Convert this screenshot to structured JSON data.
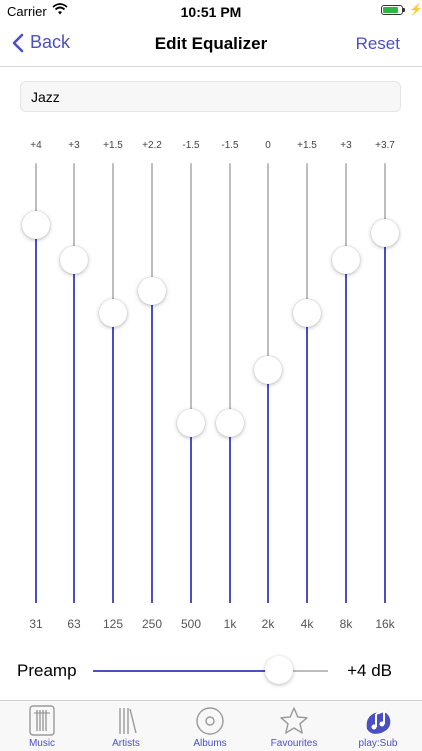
{
  "status_bar": {
    "carrier": "Carrier",
    "time": "10:51 PM"
  },
  "nav": {
    "back_label": "Back",
    "title": "Edit Equalizer",
    "reset_label": "Reset"
  },
  "preset": {
    "value": "Jazz"
  },
  "equalizer": {
    "range_db": [
      -12,
      12
    ],
    "bands": [
      {
        "label": "31",
        "value_text": "+4",
        "level": 0.86
      },
      {
        "label": "63",
        "value_text": "+3",
        "level": 0.78
      },
      {
        "label": "125",
        "value_text": "+1.5",
        "level": 0.66
      },
      {
        "label": "250",
        "value_text": "+2.2",
        "level": 0.71
      },
      {
        "label": "500",
        "value_text": "-1.5",
        "level": 0.41
      },
      {
        "label": "1k",
        "value_text": "-1.5",
        "level": 0.41
      },
      {
        "label": "2k",
        "value_text": "0",
        "level": 0.53
      },
      {
        "label": "4k",
        "value_text": "+1.5",
        "level": 0.66
      },
      {
        "label": "8k",
        "value_text": "+3",
        "level": 0.78
      },
      {
        "label": "16k",
        "value_text": "+3.7",
        "level": 0.84
      }
    ]
  },
  "preamp": {
    "label": "Preamp",
    "value_text": "+4 dB",
    "level": 0.79
  },
  "tabs": [
    {
      "label": "Music",
      "icon": "music-library-icon"
    },
    {
      "label": "Artists",
      "icon": "artists-icon"
    },
    {
      "label": "Albums",
      "icon": "album-disc-icon"
    },
    {
      "label": "Favourites",
      "icon": "star-icon"
    },
    {
      "label": "play:Sub",
      "icon": "playsub-logo-icon"
    }
  ],
  "colors": {
    "accent": "#4b4fc4",
    "track_inactive": "#bdbdbd",
    "tab_icon_inactive": "#9a9a9a"
  }
}
